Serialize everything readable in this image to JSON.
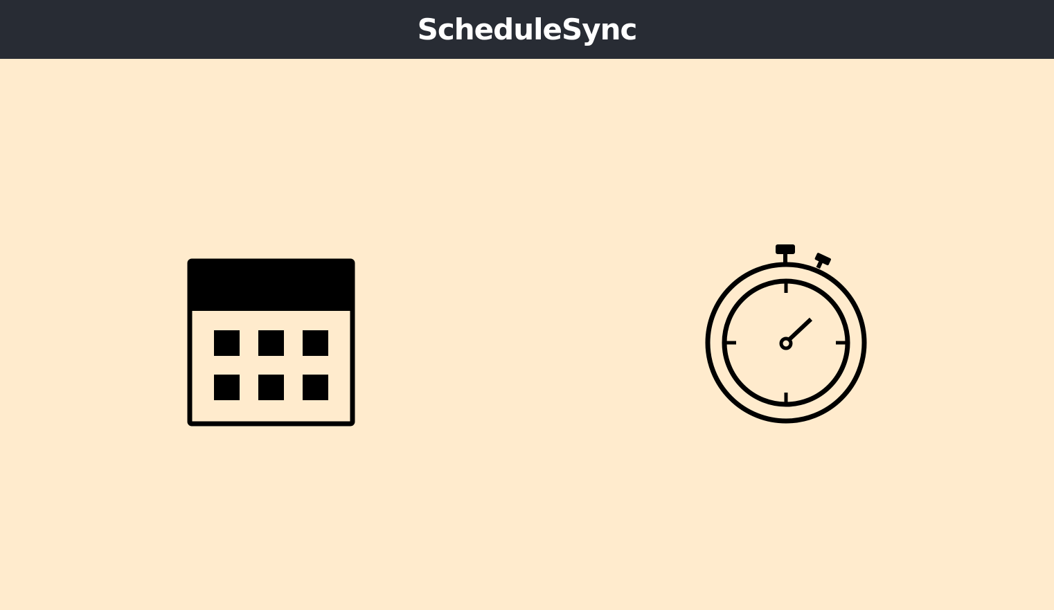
{
  "header": {
    "title": "ScheduleSync"
  },
  "icons": {
    "calendar": "calendar-icon",
    "stopwatch": "stopwatch-icon"
  },
  "colors": {
    "header_bg": "#282C34",
    "page_bg": "#FFEBCD",
    "icon": "#000000",
    "title": "#FFFFFF"
  }
}
